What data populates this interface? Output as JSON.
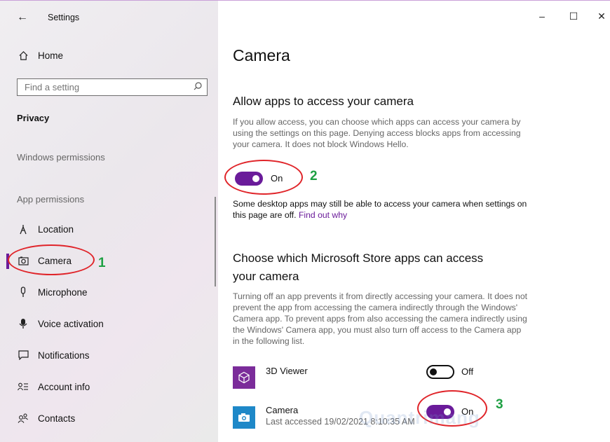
{
  "window": {
    "title": "Settings",
    "controls": {
      "minimize": "–",
      "maximize": "☐",
      "close": "✕"
    }
  },
  "sidebar": {
    "home_label": "Home",
    "search": {
      "placeholder": "Find a setting",
      "value": ""
    },
    "section_title": "Privacy",
    "group_windows": "Windows permissions",
    "group_app": "App permissions",
    "items": [
      {
        "label": "Location",
        "icon": "location-icon"
      },
      {
        "label": "Camera",
        "icon": "camera-icon",
        "selected": true
      },
      {
        "label": "Microphone",
        "icon": "microphone-icon"
      },
      {
        "label": "Voice activation",
        "icon": "voice-activation-icon"
      },
      {
        "label": "Notifications",
        "icon": "notifications-icon"
      },
      {
        "label": "Account info",
        "icon": "account-info-icon"
      },
      {
        "label": "Contacts",
        "icon": "contacts-icon"
      }
    ]
  },
  "main": {
    "page_title": "Camera",
    "allow_section": {
      "heading": "Allow apps to access your camera",
      "description": "If you allow access, you can choose which apps can access your camera by using the settings on this page. Denying access blocks apps from accessing your camera. It does not block Windows Hello.",
      "toggle_label": "On",
      "toggle_state": "on",
      "note": "Some desktop apps may still be able to access your camera when settings on this page are off.",
      "note_link": "Find out why"
    },
    "choose_section": {
      "heading_line1": "Choose which Microsoft Store apps can access",
      "heading_line2": "your camera",
      "description": "Turning off an app prevents it from directly accessing your camera. It does not prevent the app from accessing the camera indirectly through the Windows' Camera app. To prevent apps from also accessing the camera indirectly using the Windows' Camera app, you must also turn off access to the Camera app in the following list."
    },
    "apps": [
      {
        "name": "3D Viewer",
        "sub": "",
        "toggle_label": "Off",
        "toggle_state": "off",
        "icon": "3d-viewer-icon",
        "tile_color": "#7b2c9a"
      },
      {
        "name": "Camera",
        "sub": "Last accessed 19/02/2021 8:10:35 AM",
        "toggle_label": "On",
        "toggle_state": "on",
        "icon": "camera-app-icon",
        "tile_color": "#1e88c8"
      }
    ]
  },
  "annotations": {
    "step1": "1",
    "step2": "2",
    "step3": "3",
    "ellipse_color": "#e0252a",
    "number_color": "#1ea043"
  },
  "watermark": "Quantrimang",
  "colors": {
    "accent": "#6a1b9a",
    "link": "#6a1b9a"
  }
}
